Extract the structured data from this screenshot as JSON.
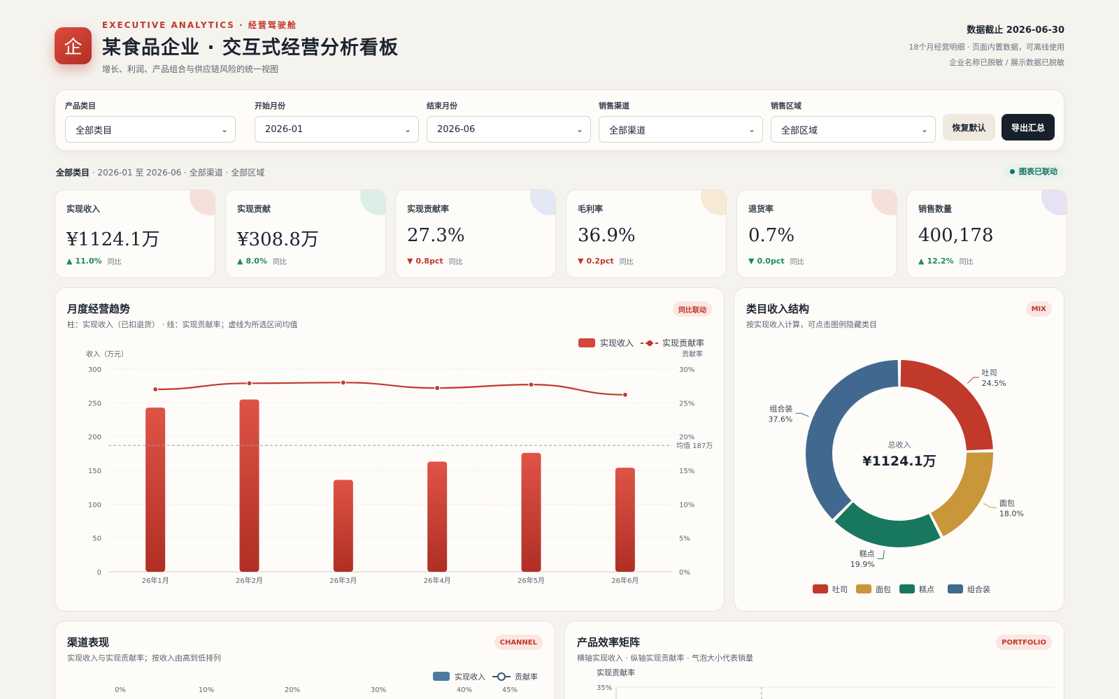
{
  "header": {
    "logo_char": "企",
    "eyebrow": "EXECUTIVE ANALYTICS · 经营驾驶舱",
    "title": "某食品企业 · 交互式经营分析看板",
    "subtitle": "增长、利润、产品组合与供应链风险的统一视图",
    "data_date": "数据截止 2026-06-30",
    "meta_line1": "18个月经营明细 · 页面内置数据，可离线使用",
    "meta_line2": "企业名称已脱敏 / 展示数据已脱敏"
  },
  "filters": {
    "category": {
      "label": "产品类目",
      "value": "全部类目"
    },
    "start": {
      "label": "开始月份",
      "value": "2026-01"
    },
    "end": {
      "label": "结束月份",
      "value": "2026-06"
    },
    "channel": {
      "label": "销售渠道",
      "value": "全部渠道"
    },
    "region": {
      "label": "销售区域",
      "value": "全部区域"
    },
    "reset_label": "恢复默认",
    "export_label": "导出汇总"
  },
  "crumb": {
    "category": "全部类目",
    "rest": " · 2026-01 至 2026-06 · 全部渠道 · 全部区域"
  },
  "linked_badge": "图表已联动",
  "kpis": [
    {
      "label": "实现收入",
      "value": "¥1124.1万",
      "arrow": "▲",
      "change": "11.0%",
      "yoy": "同比",
      "dir": "up",
      "blob": "#f6e0dc"
    },
    {
      "label": "实现贡献",
      "value": "¥308.8万",
      "arrow": "▲",
      "change": "8.0%",
      "yoy": "同比",
      "dir": "up",
      "blob": "#dcefe6"
    },
    {
      "label": "实现贡献率",
      "value": "27.3%",
      "arrow": "▼",
      "change": "0.8pct",
      "yoy": "同比",
      "dir": "down",
      "blob": "#e3e7f4"
    },
    {
      "label": "毛利率",
      "value": "36.9%",
      "arrow": "▼",
      "change": "0.2pct",
      "yoy": "同比",
      "dir": "down",
      "blob": "#f6ead6"
    },
    {
      "label": "退货率",
      "value": "0.7%",
      "arrow": "▼",
      "change": "0.0pct",
      "yoy": "同比",
      "dir": "up",
      "blob": "#f6e0dc"
    },
    {
      "label": "销售数量",
      "value": "400,178",
      "arrow": "▲",
      "change": "12.2%",
      "yoy": "同比",
      "dir": "up",
      "blob": "#e6e2f2"
    }
  ],
  "trend": {
    "title": "月度经营趋势",
    "subtitle": "柱：实现收入（已扣退货） · 线：实现贡献率；虚线为所选区间均值",
    "tag": "同比联动",
    "legend_bar": "实现收入",
    "legend_line": "实现贡献率",
    "y_left_label": "收入（万元）",
    "y_right_label": "贡献率",
    "avg_label": "均值 187万"
  },
  "mix": {
    "title": "类目收入结构",
    "subtitle": "按实现收入计算，可点击图例隐藏类目",
    "tag": "MIX",
    "center_label": "总收入",
    "center_value": "¥1124.1万"
  },
  "channel": {
    "title": "渠道表现",
    "subtitle": "实现收入与实现贡献率；按收入由高到低排列",
    "tag": "CHANNEL",
    "legend_bar": "实现收入",
    "legend_line": "贡献率",
    "axis_ticks": [
      "0%",
      "10%",
      "20%",
      "30%",
      "40%",
      "45%"
    ]
  },
  "portfolio": {
    "title": "产品效率矩阵",
    "subtitle": "横轴实现收入 · 纵轴实现贡献率 · 气泡大小代表销量",
    "tag": "PORTFOLIO",
    "y_label": "实现贡献率",
    "y_top_tick": "35%"
  },
  "colors": {
    "accent": "#c0392b",
    "bar": "#d9483b",
    "toast": "#c0392b",
    "bread": "#c9963a",
    "cake": "#17775f",
    "combo": "#41698f"
  },
  "chart_data": [
    {
      "type": "bar",
      "title": "月度经营趋势",
      "categories": [
        "26年1月",
        "26年2月",
        "26年3月",
        "26年4月",
        "26年5月",
        "26年6月"
      ],
      "series": [
        {
          "name": "实现收入",
          "type": "bar",
          "axis": "left",
          "values": [
            243,
            255,
            136,
            163,
            176,
            154
          ]
        },
        {
          "name": "实现贡献率",
          "type": "line",
          "axis": "right",
          "values": [
            27.0,
            27.9,
            28.0,
            27.2,
            27.7,
            26.2
          ]
        }
      ],
      "average": 187,
      "ylabel": "收入（万元）",
      "ylim": [
        0,
        300
      ],
      "yticks": [
        0,
        50,
        100,
        150,
        200,
        250,
        300
      ],
      "y2label": "贡献率",
      "y2lim": [
        0,
        30
      ],
      "y2ticks": [
        "0%",
        "5%",
        "10%",
        "15%",
        "20%",
        "25%",
        "30%"
      ],
      "legend": "top-right",
      "grid": true
    },
    {
      "type": "pie",
      "title": "类目收入结构",
      "slices": [
        {
          "name": "吐司",
          "value": 24.5,
          "label": "24.5%"
        },
        {
          "name": "面包",
          "value": 18.0,
          "label": "18.0%"
        },
        {
          "name": "糕点",
          "value": 19.9,
          "label": "19.9%"
        },
        {
          "name": "组合装",
          "value": 37.6,
          "label": "37.6%"
        }
      ],
      "legend": "bottom"
    }
  ]
}
